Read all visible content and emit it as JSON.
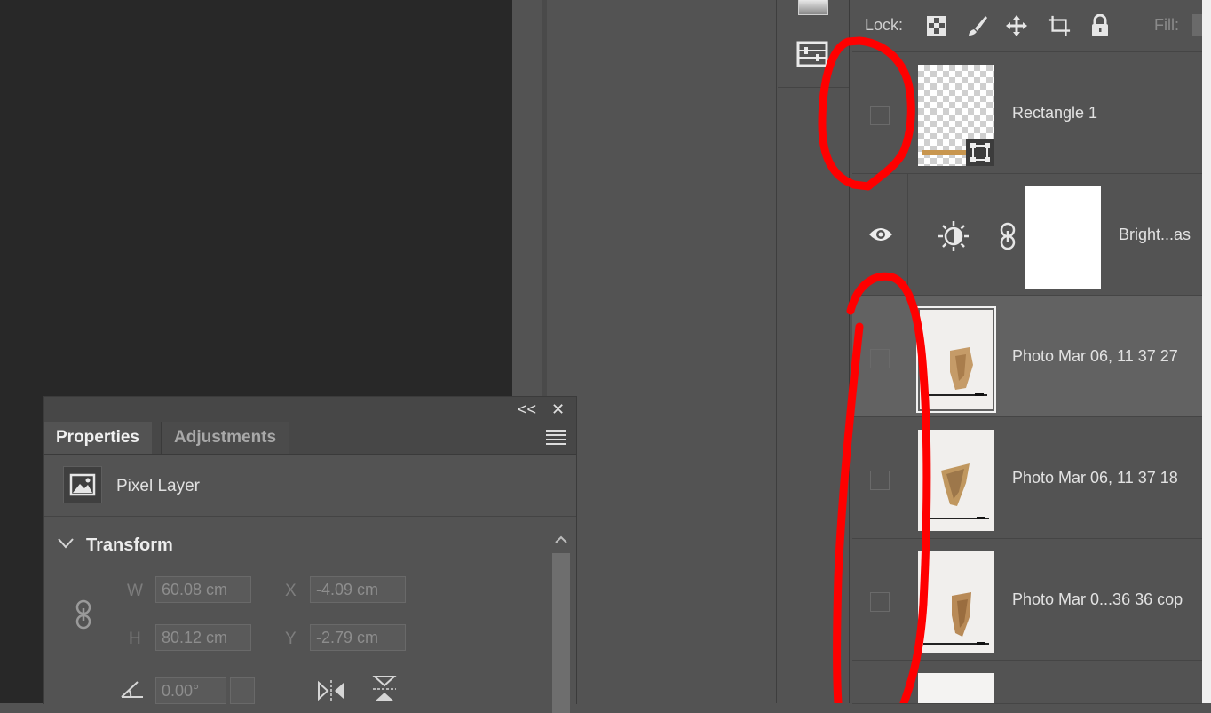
{
  "layers_panel": {
    "lock_label": "Lock:",
    "fill_label": "Fill:",
    "lock_icons": [
      "lock-transparent-pixels-icon",
      "lock-image-pixels-icon",
      "lock-position-icon",
      "lock-artboard-icon",
      "lock-all-icon"
    ],
    "layers": [
      {
        "name": "Rectangle 1",
        "visible": false,
        "kind": "shape"
      },
      {
        "name": "Bright...as",
        "visible": true,
        "kind": "adjustment"
      },
      {
        "name": "Photo Mar 06, 11 37 27",
        "visible": false,
        "kind": "pixel",
        "selected": true
      },
      {
        "name": "Photo Mar 06, 11 37 18",
        "visible": false,
        "kind": "pixel"
      },
      {
        "name": "Photo Mar 0...36 36 cop",
        "visible": false,
        "kind": "pixel"
      }
    ]
  },
  "properties_panel": {
    "tabs": [
      {
        "label": "Properties",
        "active": true
      },
      {
        "label": "Adjustments",
        "active": false
      }
    ],
    "layer_type": "Pixel Layer",
    "section_title": "Transform",
    "fields": {
      "w_label": "W",
      "w_value": "60.08 cm",
      "h_label": "H",
      "h_value": "80.12 cm",
      "x_label": "X",
      "x_value": "-4.09 cm",
      "y_label": "Y",
      "y_value": "-2.79 cm",
      "angle_value": "0.00°"
    },
    "collapse_glyph": "<<",
    "close_glyph": "✕"
  },
  "colors": {
    "annotation": "#ff0000",
    "panel_bg": "#535353",
    "canvas_bg": "#282828"
  }
}
